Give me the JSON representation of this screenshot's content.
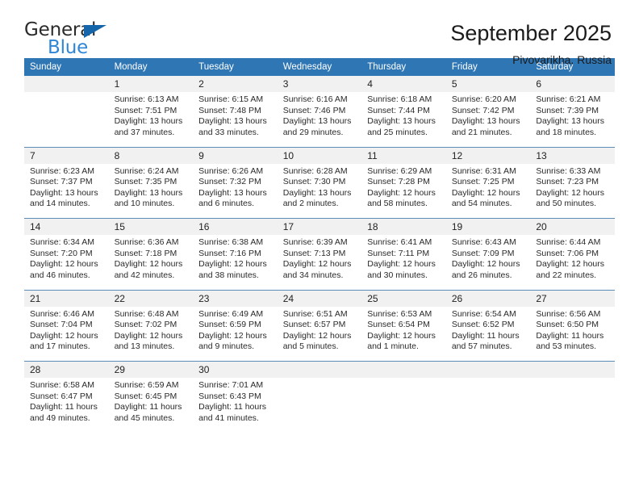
{
  "logo": {
    "word_top": "General",
    "word_bottom": "Blue",
    "triangle_color": "#1565ab",
    "bottom_color": "#2f86d6"
  },
  "header": {
    "title": "September 2025",
    "subtitle": "Pivovarikha, Russia"
  },
  "theme": {
    "header_blue": "#2f76b5",
    "daynum_band": "#f1f1f1",
    "separator": "#5b8db8"
  },
  "weekday_headers": [
    "Sunday",
    "Monday",
    "Tuesday",
    "Wednesday",
    "Thursday",
    "Friday",
    "Saturday"
  ],
  "weeks": [
    {
      "days": [
        {
          "num": "",
          "sunrise": "",
          "sunset": "",
          "daylight1": "",
          "daylight2": ""
        },
        {
          "num": "1",
          "sunrise": "Sunrise: 6:13 AM",
          "sunset": "Sunset: 7:51 PM",
          "daylight1": "Daylight: 13 hours",
          "daylight2": "and 37 minutes."
        },
        {
          "num": "2",
          "sunrise": "Sunrise: 6:15 AM",
          "sunset": "Sunset: 7:48 PM",
          "daylight1": "Daylight: 13 hours",
          "daylight2": "and 33 minutes."
        },
        {
          "num": "3",
          "sunrise": "Sunrise: 6:16 AM",
          "sunset": "Sunset: 7:46 PM",
          "daylight1": "Daylight: 13 hours",
          "daylight2": "and 29 minutes."
        },
        {
          "num": "4",
          "sunrise": "Sunrise: 6:18 AM",
          "sunset": "Sunset: 7:44 PM",
          "daylight1": "Daylight: 13 hours",
          "daylight2": "and 25 minutes."
        },
        {
          "num": "5",
          "sunrise": "Sunrise: 6:20 AM",
          "sunset": "Sunset: 7:42 PM",
          "daylight1": "Daylight: 13 hours",
          "daylight2": "and 21 minutes."
        },
        {
          "num": "6",
          "sunrise": "Sunrise: 6:21 AM",
          "sunset": "Sunset: 7:39 PM",
          "daylight1": "Daylight: 13 hours",
          "daylight2": "and 18 minutes."
        }
      ]
    },
    {
      "days": [
        {
          "num": "7",
          "sunrise": "Sunrise: 6:23 AM",
          "sunset": "Sunset: 7:37 PM",
          "daylight1": "Daylight: 13 hours",
          "daylight2": "and 14 minutes."
        },
        {
          "num": "8",
          "sunrise": "Sunrise: 6:24 AM",
          "sunset": "Sunset: 7:35 PM",
          "daylight1": "Daylight: 13 hours",
          "daylight2": "and 10 minutes."
        },
        {
          "num": "9",
          "sunrise": "Sunrise: 6:26 AM",
          "sunset": "Sunset: 7:32 PM",
          "daylight1": "Daylight: 13 hours",
          "daylight2": "and 6 minutes."
        },
        {
          "num": "10",
          "sunrise": "Sunrise: 6:28 AM",
          "sunset": "Sunset: 7:30 PM",
          "daylight1": "Daylight: 13 hours",
          "daylight2": "and 2 minutes."
        },
        {
          "num": "11",
          "sunrise": "Sunrise: 6:29 AM",
          "sunset": "Sunset: 7:28 PM",
          "daylight1": "Daylight: 12 hours",
          "daylight2": "and 58 minutes."
        },
        {
          "num": "12",
          "sunrise": "Sunrise: 6:31 AM",
          "sunset": "Sunset: 7:25 PM",
          "daylight1": "Daylight: 12 hours",
          "daylight2": "and 54 minutes."
        },
        {
          "num": "13",
          "sunrise": "Sunrise: 6:33 AM",
          "sunset": "Sunset: 7:23 PM",
          "daylight1": "Daylight: 12 hours",
          "daylight2": "and 50 minutes."
        }
      ]
    },
    {
      "days": [
        {
          "num": "14",
          "sunrise": "Sunrise: 6:34 AM",
          "sunset": "Sunset: 7:20 PM",
          "daylight1": "Daylight: 12 hours",
          "daylight2": "and 46 minutes."
        },
        {
          "num": "15",
          "sunrise": "Sunrise: 6:36 AM",
          "sunset": "Sunset: 7:18 PM",
          "daylight1": "Daylight: 12 hours",
          "daylight2": "and 42 minutes."
        },
        {
          "num": "16",
          "sunrise": "Sunrise: 6:38 AM",
          "sunset": "Sunset: 7:16 PM",
          "daylight1": "Daylight: 12 hours",
          "daylight2": "and 38 minutes."
        },
        {
          "num": "17",
          "sunrise": "Sunrise: 6:39 AM",
          "sunset": "Sunset: 7:13 PM",
          "daylight1": "Daylight: 12 hours",
          "daylight2": "and 34 minutes."
        },
        {
          "num": "18",
          "sunrise": "Sunrise: 6:41 AM",
          "sunset": "Sunset: 7:11 PM",
          "daylight1": "Daylight: 12 hours",
          "daylight2": "and 30 minutes."
        },
        {
          "num": "19",
          "sunrise": "Sunrise: 6:43 AM",
          "sunset": "Sunset: 7:09 PM",
          "daylight1": "Daylight: 12 hours",
          "daylight2": "and 26 minutes."
        },
        {
          "num": "20",
          "sunrise": "Sunrise: 6:44 AM",
          "sunset": "Sunset: 7:06 PM",
          "daylight1": "Daylight: 12 hours",
          "daylight2": "and 22 minutes."
        }
      ]
    },
    {
      "days": [
        {
          "num": "21",
          "sunrise": "Sunrise: 6:46 AM",
          "sunset": "Sunset: 7:04 PM",
          "daylight1": "Daylight: 12 hours",
          "daylight2": "and 17 minutes."
        },
        {
          "num": "22",
          "sunrise": "Sunrise: 6:48 AM",
          "sunset": "Sunset: 7:02 PM",
          "daylight1": "Daylight: 12 hours",
          "daylight2": "and 13 minutes."
        },
        {
          "num": "23",
          "sunrise": "Sunrise: 6:49 AM",
          "sunset": "Sunset: 6:59 PM",
          "daylight1": "Daylight: 12 hours",
          "daylight2": "and 9 minutes."
        },
        {
          "num": "24",
          "sunrise": "Sunrise: 6:51 AM",
          "sunset": "Sunset: 6:57 PM",
          "daylight1": "Daylight: 12 hours",
          "daylight2": "and 5 minutes."
        },
        {
          "num": "25",
          "sunrise": "Sunrise: 6:53 AM",
          "sunset": "Sunset: 6:54 PM",
          "daylight1": "Daylight: 12 hours",
          "daylight2": "and 1 minute."
        },
        {
          "num": "26",
          "sunrise": "Sunrise: 6:54 AM",
          "sunset": "Sunset: 6:52 PM",
          "daylight1": "Daylight: 11 hours",
          "daylight2": "and 57 minutes."
        },
        {
          "num": "27",
          "sunrise": "Sunrise: 6:56 AM",
          "sunset": "Sunset: 6:50 PM",
          "daylight1": "Daylight: 11 hours",
          "daylight2": "and 53 minutes."
        }
      ]
    },
    {
      "days": [
        {
          "num": "28",
          "sunrise": "Sunrise: 6:58 AM",
          "sunset": "Sunset: 6:47 PM",
          "daylight1": "Daylight: 11 hours",
          "daylight2": "and 49 minutes."
        },
        {
          "num": "29",
          "sunrise": "Sunrise: 6:59 AM",
          "sunset": "Sunset: 6:45 PM",
          "daylight1": "Daylight: 11 hours",
          "daylight2": "and 45 minutes."
        },
        {
          "num": "30",
          "sunrise": "Sunrise: 7:01 AM",
          "sunset": "Sunset: 6:43 PM",
          "daylight1": "Daylight: 11 hours",
          "daylight2": "and 41 minutes."
        },
        {
          "num": "",
          "sunrise": "",
          "sunset": "",
          "daylight1": "",
          "daylight2": ""
        },
        {
          "num": "",
          "sunrise": "",
          "sunset": "",
          "daylight1": "",
          "daylight2": ""
        },
        {
          "num": "",
          "sunrise": "",
          "sunset": "",
          "daylight1": "",
          "daylight2": ""
        },
        {
          "num": "",
          "sunrise": "",
          "sunset": "",
          "daylight1": "",
          "daylight2": ""
        }
      ]
    }
  ]
}
